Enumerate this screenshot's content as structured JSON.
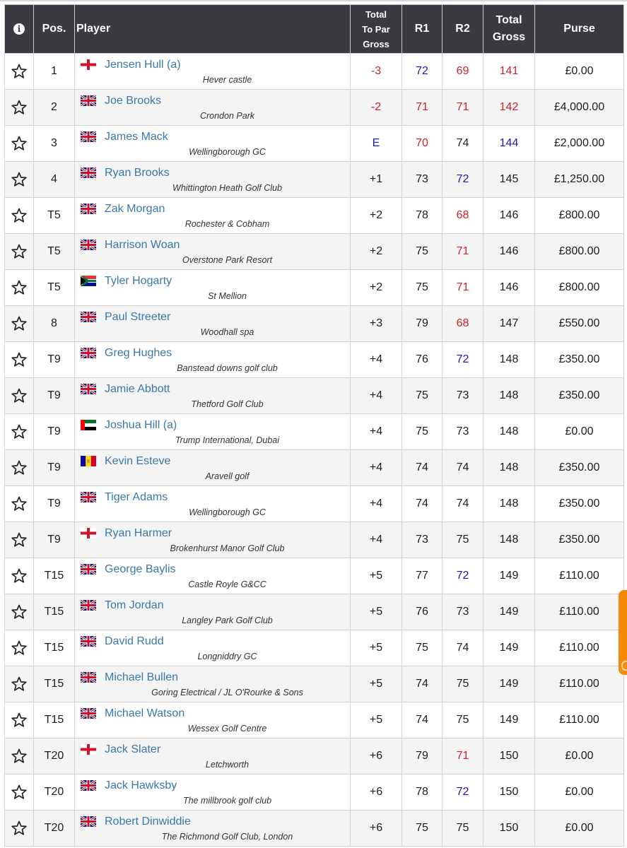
{
  "header": {
    "info_icon": "info-icon",
    "pos": "Pos.",
    "player": "Player",
    "topar": [
      "Total",
      "To Par",
      "Gross"
    ],
    "r1": "R1",
    "r2": "R2",
    "total": [
      "Total",
      "Gross"
    ],
    "purse": "Purse"
  },
  "colors": {
    "header_bg": "#3b3a40",
    "under_par": "#d0202a",
    "even_par": "#1a1ab0",
    "player_link": "#3a78ac",
    "row_alt": "#f4f4f4",
    "side_tab": "#f7890a"
  },
  "rows": [
    {
      "pos": "1",
      "flag": "england",
      "name": "Jensen Hull (a)",
      "club": "Hever castle",
      "topar": "-3",
      "topar_c": "red",
      "r1": "72",
      "r1_c": "blue",
      "r2": "69",
      "r2_c": "red",
      "total": "141",
      "total_c": "red",
      "purse": "£0.00"
    },
    {
      "pos": "2",
      "flag": "uk",
      "name": "Joe Brooks",
      "club": "Crondon Park",
      "topar": "-2",
      "topar_c": "red",
      "r1": "71",
      "r1_c": "red",
      "r2": "71",
      "r2_c": "red",
      "total": "142",
      "total_c": "red",
      "purse": "£4,000.00"
    },
    {
      "pos": "3",
      "flag": "uk",
      "name": "James Mack",
      "club": "Wellingborough GC",
      "topar": "E",
      "topar_c": "blue",
      "r1": "70",
      "r1_c": "red",
      "r2": "74",
      "r2_c": "",
      "total": "144",
      "total_c": "blue",
      "purse": "£2,000.00"
    },
    {
      "pos": "4",
      "flag": "uk",
      "name": "Ryan Brooks",
      "club": "Whittington Heath Golf Club",
      "topar": "+1",
      "topar_c": "",
      "r1": "73",
      "r1_c": "",
      "r2": "72",
      "r2_c": "blue",
      "total": "145",
      "total_c": "",
      "purse": "£1,250.00"
    },
    {
      "pos": "T5",
      "flag": "uk",
      "name": "Zak Morgan",
      "club": "Rochester & Cobham",
      "topar": "+2",
      "topar_c": "",
      "r1": "78",
      "r1_c": "",
      "r2": "68",
      "r2_c": "red",
      "total": "146",
      "total_c": "",
      "purse": "£800.00"
    },
    {
      "pos": "T5",
      "flag": "uk",
      "name": "Harrison Woan",
      "club": "Overstone Park Resort",
      "topar": "+2",
      "topar_c": "",
      "r1": "75",
      "r1_c": "",
      "r2": "71",
      "r2_c": "red",
      "total": "146",
      "total_c": "",
      "purse": "£800.00"
    },
    {
      "pos": "T5",
      "flag": "south-africa",
      "name": "Tyler Hogarty",
      "club": "St Mellion",
      "topar": "+2",
      "topar_c": "",
      "r1": "75",
      "r1_c": "",
      "r2": "71",
      "r2_c": "red",
      "total": "146",
      "total_c": "",
      "purse": "£800.00"
    },
    {
      "pos": "8",
      "flag": "uk",
      "name": "Paul Streeter",
      "club": "Woodhall spa",
      "topar": "+3",
      "topar_c": "",
      "r1": "79",
      "r1_c": "",
      "r2": "68",
      "r2_c": "red",
      "total": "147",
      "total_c": "",
      "purse": "£550.00"
    },
    {
      "pos": "T9",
      "flag": "uk",
      "name": "Greg Hughes",
      "club": "Banstead downs golf club",
      "topar": "+4",
      "topar_c": "",
      "r1": "76",
      "r1_c": "",
      "r2": "72",
      "r2_c": "blue",
      "total": "148",
      "total_c": "",
      "purse": "£350.00"
    },
    {
      "pos": "T9",
      "flag": "uk",
      "name": "Jamie Abbott",
      "club": "Thetford Golf Club",
      "topar": "+4",
      "topar_c": "",
      "r1": "75",
      "r1_c": "",
      "r2": "73",
      "r2_c": "",
      "total": "148",
      "total_c": "",
      "purse": "£350.00"
    },
    {
      "pos": "T9",
      "flag": "uae",
      "name": "Joshua Hill (a)",
      "club": "Trump International, Dubai",
      "topar": "+4",
      "topar_c": "",
      "r1": "75",
      "r1_c": "",
      "r2": "73",
      "r2_c": "",
      "total": "148",
      "total_c": "",
      "purse": "£0.00"
    },
    {
      "pos": "T9",
      "flag": "andorra",
      "name": "Kevin Esteve",
      "club": "Aravell golf",
      "topar": "+4",
      "topar_c": "",
      "r1": "74",
      "r1_c": "",
      "r2": "74",
      "r2_c": "",
      "total": "148",
      "total_c": "",
      "purse": "£350.00"
    },
    {
      "pos": "T9",
      "flag": "uk",
      "name": "Tiger Adams",
      "club": "Wellingborough GC",
      "topar": "+4",
      "topar_c": "",
      "r1": "74",
      "r1_c": "",
      "r2": "74",
      "r2_c": "",
      "total": "148",
      "total_c": "",
      "purse": "£350.00"
    },
    {
      "pos": "T9",
      "flag": "england",
      "name": "Ryan Harmer",
      "club": "Brokenhurst Manor Golf Club",
      "topar": "+4",
      "topar_c": "",
      "r1": "73",
      "r1_c": "",
      "r2": "75",
      "r2_c": "",
      "total": "148",
      "total_c": "",
      "purse": "£350.00"
    },
    {
      "pos": "T15",
      "flag": "uk",
      "name": "George Baylis",
      "club": "Castle Royle G&CC",
      "topar": "+5",
      "topar_c": "",
      "r1": "77",
      "r1_c": "",
      "r2": "72",
      "r2_c": "blue",
      "total": "149",
      "total_c": "",
      "purse": "£110.00"
    },
    {
      "pos": "T15",
      "flag": "uk",
      "name": "Tom Jordan",
      "club": "Langley Park Golf Club",
      "topar": "+5",
      "topar_c": "",
      "r1": "76",
      "r1_c": "",
      "r2": "73",
      "r2_c": "",
      "total": "149",
      "total_c": "",
      "purse": "£110.00"
    },
    {
      "pos": "T15",
      "flag": "uk",
      "name": "David Rudd",
      "club": "Longniddry GC",
      "topar": "+5",
      "topar_c": "",
      "r1": "75",
      "r1_c": "",
      "r2": "74",
      "r2_c": "",
      "total": "149",
      "total_c": "",
      "purse": "£110.00"
    },
    {
      "pos": "T15",
      "flag": "uk",
      "name": "Michael Bullen",
      "club": "Goring Electrical / JL O'Rourke & Sons",
      "topar": "+5",
      "topar_c": "",
      "r1": "74",
      "r1_c": "",
      "r2": "75",
      "r2_c": "",
      "total": "149",
      "total_c": "",
      "purse": "£110.00"
    },
    {
      "pos": "T15",
      "flag": "uk",
      "name": "Michael Watson",
      "club": "Wessex Golf Centre",
      "topar": "+5",
      "topar_c": "",
      "r1": "74",
      "r1_c": "",
      "r2": "75",
      "r2_c": "",
      "total": "149",
      "total_c": "",
      "purse": "£110.00"
    },
    {
      "pos": "T20",
      "flag": "england",
      "name": "Jack Slater",
      "club": "Letchworth",
      "topar": "+6",
      "topar_c": "",
      "r1": "79",
      "r1_c": "",
      "r2": "71",
      "r2_c": "red",
      "total": "150",
      "total_c": "",
      "purse": "£0.00"
    },
    {
      "pos": "T20",
      "flag": "uk",
      "name": "Jack Hawksby",
      "club": "The millbrook golf club",
      "topar": "+6",
      "topar_c": "",
      "r1": "78",
      "r1_c": "",
      "r2": "72",
      "r2_c": "blue",
      "total": "150",
      "total_c": "",
      "purse": "£0.00"
    },
    {
      "pos": "T20",
      "flag": "uk",
      "name": "Robert Dinwiddie",
      "club": "The Richmond Golf Club, London",
      "topar": "+6",
      "topar_c": "",
      "r1": "75",
      "r1_c": "",
      "r2": "75",
      "r2_c": "",
      "total": "150",
      "total_c": "",
      "purse": "£0.00"
    }
  ]
}
